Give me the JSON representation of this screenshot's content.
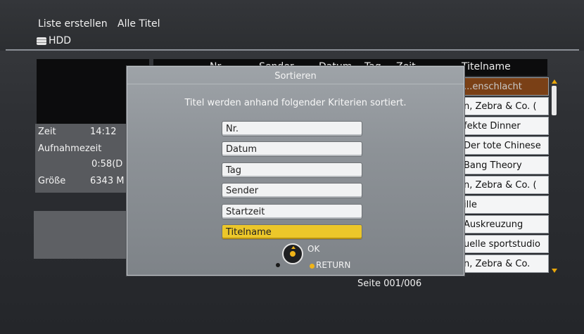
{
  "header": {
    "breadcrumb": [
      "Liste erstellen",
      "Alle Titel"
    ],
    "storage": "HDD"
  },
  "info_panel": {
    "zeit_label": "Zeit",
    "zeit_value": "14:12",
    "aufnahmezeit_label": "Aufnahmezeit",
    "aufnahmezeit_value": "0:58(D",
    "groesse_label": "Größe",
    "groesse_value": "6343 M"
  },
  "list": {
    "columns": [
      "Nr.",
      "Sender",
      "Datum",
      "Tag",
      "Zeit",
      "Titelname"
    ],
    "rows": [
      "...enschlacht",
      "n, Zebra & Co. (",
      "fekte Dinner",
      "Der tote Chinese",
      "Bang Theory",
      "n, Zebra & Co. (",
      "ille",
      "Auskreuzung",
      "uelle sportstudio",
      "n, Zebra & Co."
    ],
    "selected_row_index": 0,
    "page_label": "Seite 001/006"
  },
  "dialog": {
    "title": "Sortieren",
    "description": "Titel werden anhand folgender Kriterien sortiert.",
    "options": [
      "Nr.",
      "Datum",
      "Tag",
      "Sender",
      "Startzeit",
      "Titelname"
    ],
    "active_option": "Titelname",
    "ok_label": "OK",
    "return_label": "RETURN"
  },
  "colors": {
    "accent_yellow": "#ecc72a",
    "selected_row": "#7a4016",
    "dialog_bg": "#8d9297"
  }
}
